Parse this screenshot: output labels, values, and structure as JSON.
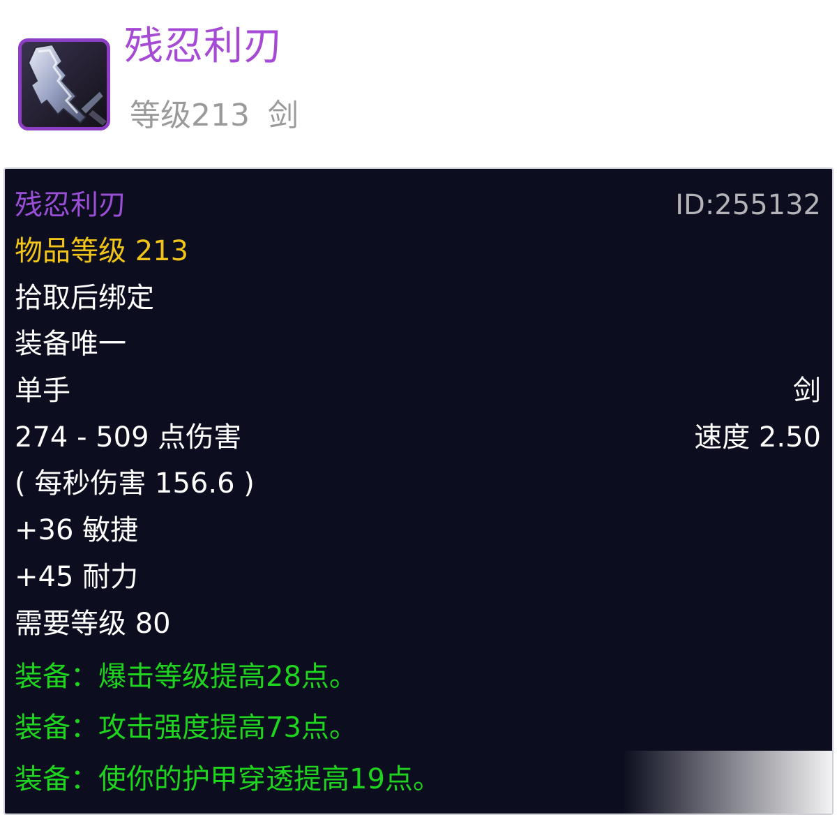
{
  "header": {
    "icon": "sword-icon",
    "item_name": "残忍利刃",
    "level_text": "等级213",
    "type_text": "剑"
  },
  "tooltip": {
    "item_name": "残忍利刃",
    "item_id": "ID:255132",
    "item_level": "物品等级 213",
    "binding": "拾取后绑定",
    "unique": "装备唯一",
    "slot": "单手",
    "weapon_type": "剑",
    "damage": "274 - 509 点伤害",
    "speed": "速度 2.50",
    "dps": "( 每秒伤害 156.6 )",
    "stat_agility": "+36 敏捷",
    "stat_stamina": "+45 耐力",
    "required_level": "需要等级 80",
    "effects": [
      "装备：爆击等级提高28点。",
      "装备：攻击强度提高73点。",
      "装备：使你的护甲穿透提高19点。"
    ]
  },
  "colors": {
    "epic_purple": "#a64ad6",
    "item_level_gold": "#f0c419",
    "equip_green": "#1ed41e",
    "tooltip_bg": "#0c0d1e"
  }
}
